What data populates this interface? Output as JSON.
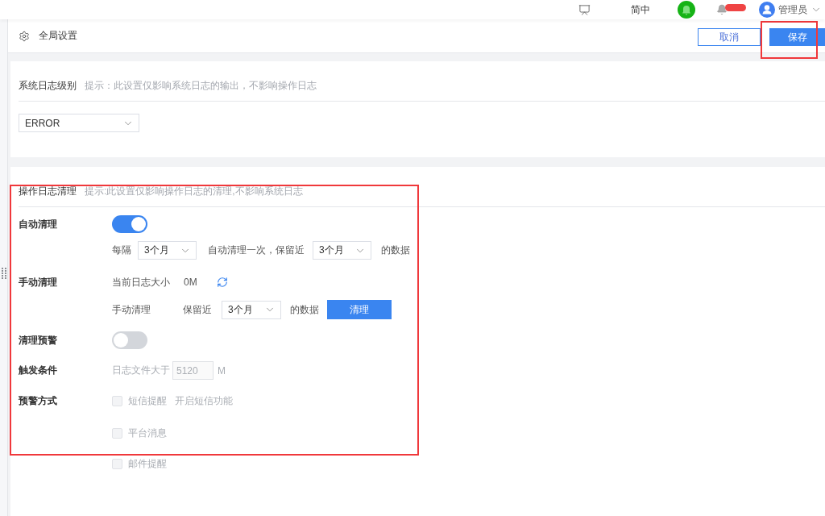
{
  "top_bar": {
    "language": "简中",
    "user": "管理员"
  },
  "page_header": {
    "title": "全局设置",
    "buttons": [
      {
        "label": "取消",
        "kind": "secondary",
        "highlighted": false
      },
      {
        "label": "保存",
        "kind": "primary",
        "highlighted": true
      }
    ]
  },
  "system_log": {
    "title": "系统日志级别",
    "hint": "提示：此设置仅影响系统日志的输出，不影响操作日志",
    "level": "ERROR"
  },
  "operation_log": {
    "title": "操作日志清理",
    "hint": "提示:此设置仅影响操作日志的清理,不影响系统日志",
    "highlighted": true,
    "auto_clean": {
      "label": "自动清理",
      "on": true,
      "interval_prefix": "每隔",
      "interval": "3个月",
      "middle": "自动清理一次，保留近",
      "retain": "3个月",
      "suffix": "的数据"
    },
    "manual_clean": {
      "label": "手动清理",
      "size_label": "当前日志大小",
      "size": "0M",
      "action_label": "手动清理",
      "retain_prefix": "保留近",
      "retain": "3个月",
      "suffix": "的数据",
      "button": "清理"
    },
    "clean_alert": {
      "label": "清理预警",
      "on": false
    },
    "trigger": {
      "label": "触发条件",
      "prefix": "日志文件大于",
      "value": "5120",
      "unit": "M",
      "disabled": true
    },
    "alert_methods": {
      "label": "预警方式",
      "options": [
        {
          "label": "短信提醒",
          "note": "开启短信功能",
          "checked": false,
          "disabled": true
        },
        {
          "label": "平台消息",
          "checked": false,
          "disabled": true
        },
        {
          "label": "邮件提醒",
          "checked": false,
          "disabled": true
        }
      ]
    }
  }
}
